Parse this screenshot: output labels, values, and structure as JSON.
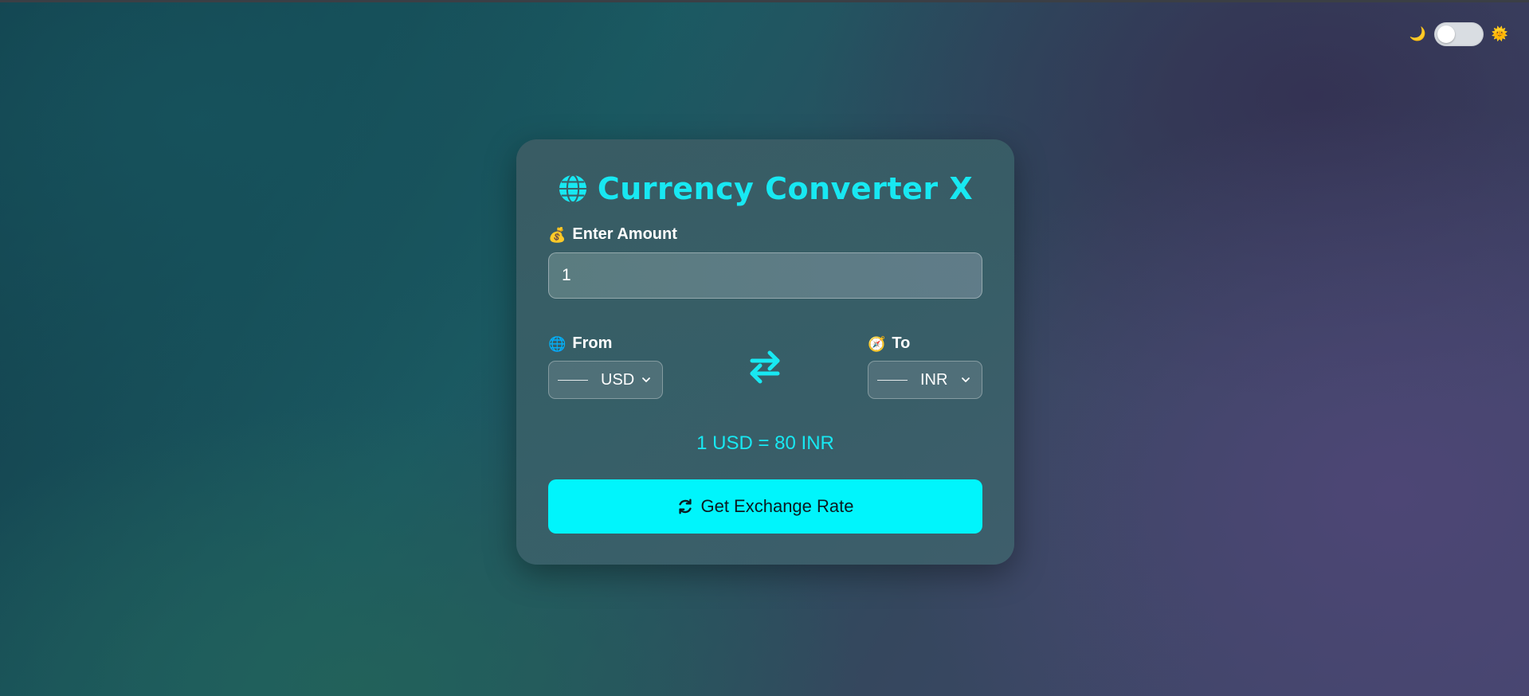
{
  "theme_toggle": {
    "left_icon": "moon-icon",
    "left_glyph": "🌙",
    "right_icon": "sun-icon",
    "right_glyph": "🌞",
    "is_on": false
  },
  "card": {
    "title": "Currency Converter X",
    "title_icon": "globe-icon",
    "amount": {
      "label": "Enter Amount",
      "icon": "money-bag-icon",
      "icon_glyph": "💰",
      "value": "1"
    },
    "from": {
      "label": "From",
      "icon": "globe-icon",
      "icon_glyph": "🌐",
      "selected": "USD"
    },
    "to": {
      "label": "To",
      "icon": "compass-icon",
      "icon_glyph": "🧭",
      "selected": "INR"
    },
    "swap_icon": "swap-arrows-icon",
    "rate_text": "1 USD = 80 INR",
    "button": {
      "label": "Get Exchange Rate",
      "icon": "sync-icon"
    }
  },
  "colors": {
    "accent": "#18e8f2",
    "button_bg": "#00f5fc",
    "text": "#ffffff"
  }
}
